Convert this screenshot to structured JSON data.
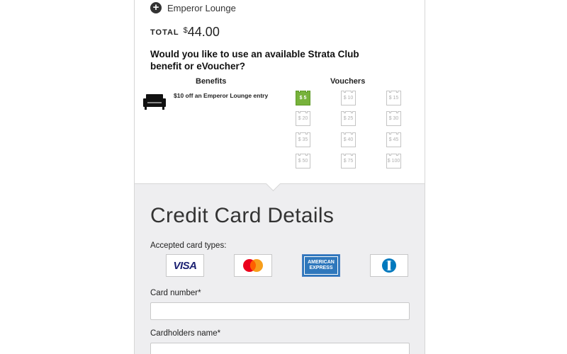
{
  "addon": {
    "label": "Emperor Lounge",
    "icon": "plus-circle-icon"
  },
  "total": {
    "label": "TOTAL",
    "currency": "$",
    "amount": "44.00"
  },
  "benefit_question": "Would you like to use an available Strata Club benefit or eVoucher?",
  "benefits": {
    "heading": "Benefits",
    "items": [
      {
        "icon": "sofa-icon",
        "text": "$10 off an Emperor Lounge entry"
      }
    ]
  },
  "vouchers": {
    "heading": "Vouchers",
    "items": [
      {
        "label": "$ 5",
        "selected": true
      },
      {
        "label": "$ 10",
        "selected": false
      },
      {
        "label": "$ 15",
        "selected": false
      },
      {
        "label": "$ 20",
        "selected": false
      },
      {
        "label": "$ 25",
        "selected": false
      },
      {
        "label": "$ 30",
        "selected": false
      },
      {
        "label": "$ 35",
        "selected": false
      },
      {
        "label": "$ 40",
        "selected": false
      },
      {
        "label": "$ 45",
        "selected": false
      },
      {
        "label": "$ 50",
        "selected": false
      },
      {
        "label": "$ 75",
        "selected": false
      },
      {
        "label": "$ 100",
        "selected": false
      }
    ],
    "selected_color": "#77b23b"
  },
  "credit_card": {
    "title": "Credit Card Details",
    "accepted_label": "Accepted card types:",
    "card_types": [
      "VISA",
      "MasterCard",
      "AMERICAN EXPRESS",
      "Diners Club"
    ],
    "card_number_label": "Card number*",
    "card_number_value": "",
    "holder_label": "Cardholders name*",
    "holder_value": ""
  }
}
